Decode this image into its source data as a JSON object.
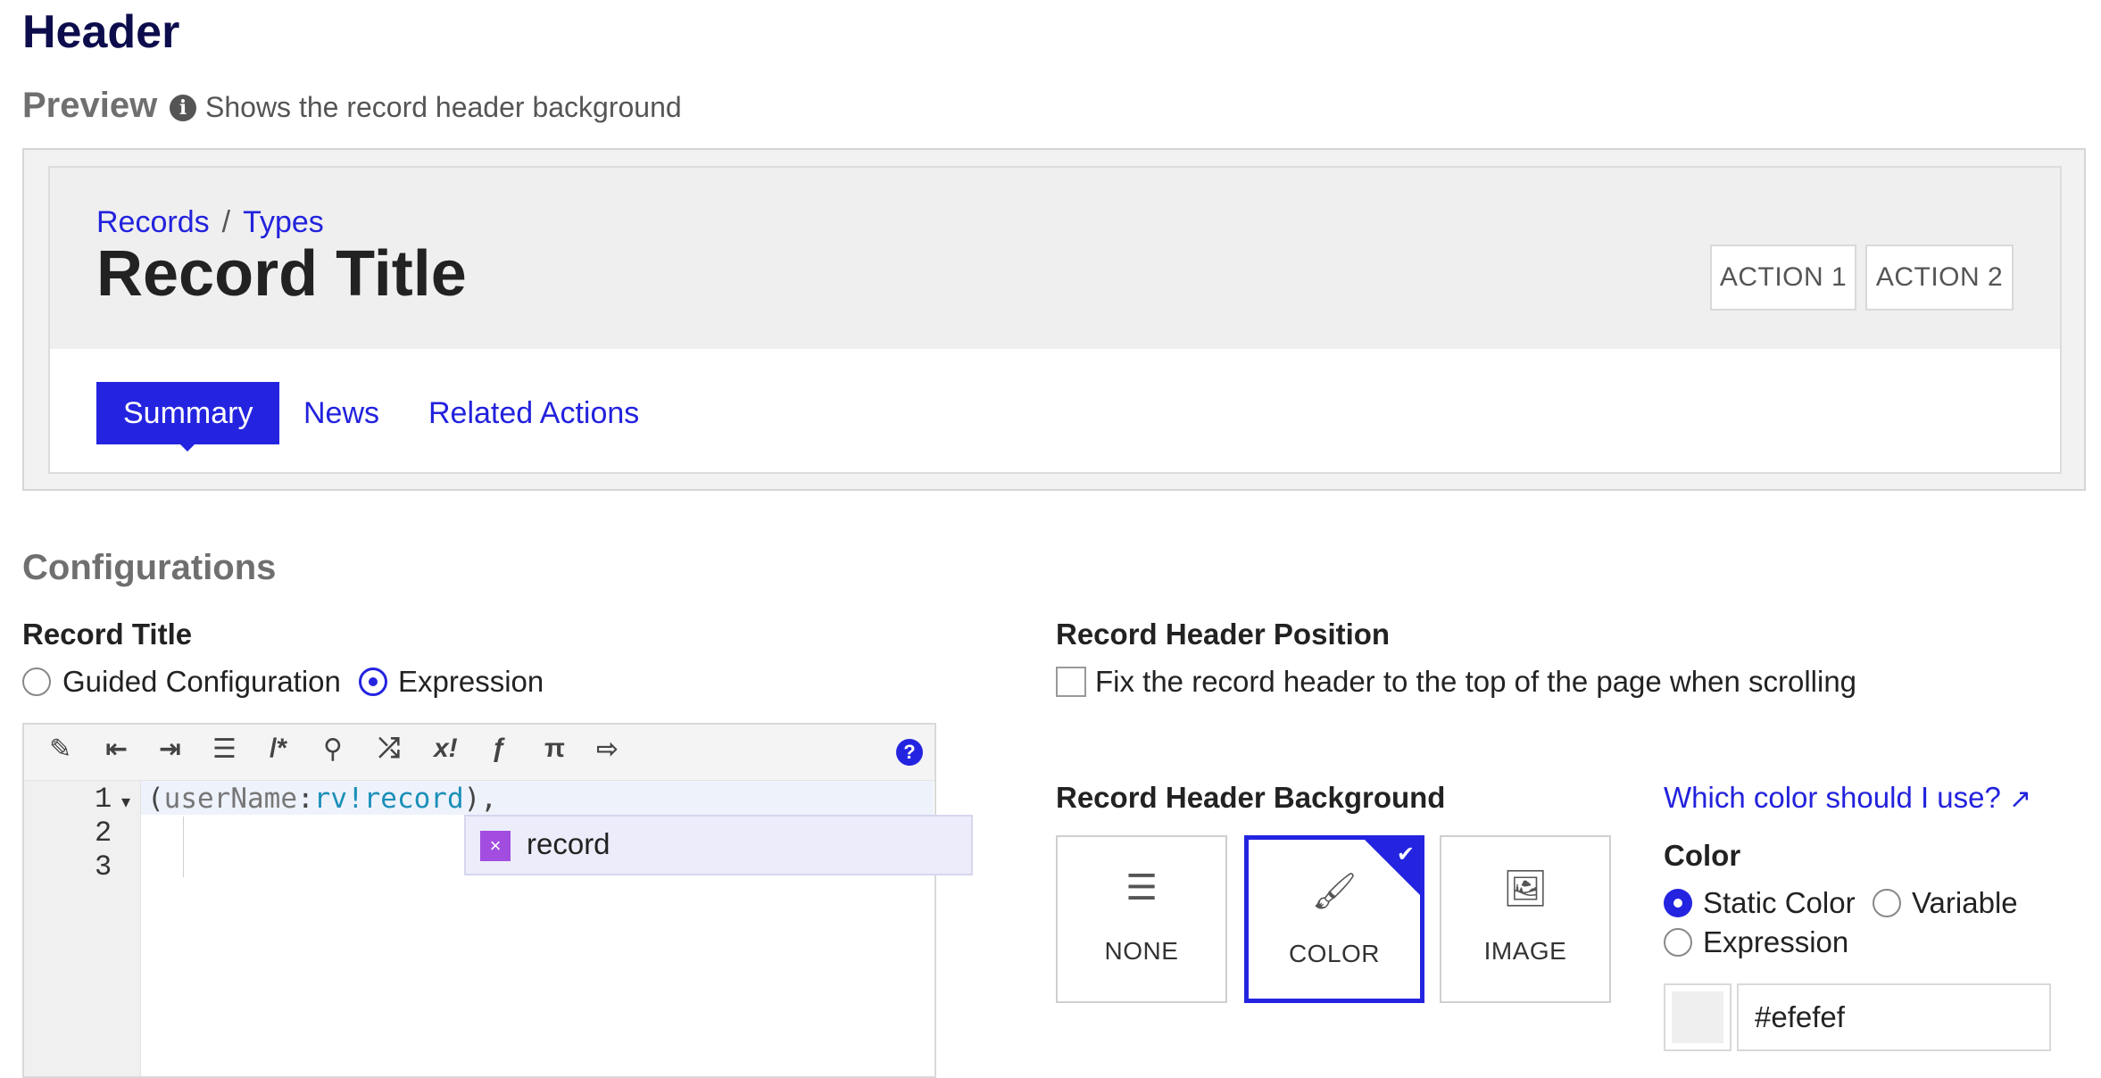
{
  "page": {
    "title": "Header"
  },
  "preview": {
    "label": "Preview",
    "hint": "Shows the record header background",
    "info_icon": "info-icon",
    "breadcrumb": [
      "Records",
      "Types"
    ],
    "breadcrumb_separator": "/",
    "record_title": "Record Title",
    "actions": [
      "ACTION 1",
      "ACTION 2"
    ],
    "tabs": [
      "Summary",
      "News",
      "Related Actions"
    ],
    "active_tab": "Summary",
    "header_background": "#efefef",
    "accent_color": "#2424e0"
  },
  "configurations": {
    "title": "Configurations",
    "record_title": {
      "label": "Record Title",
      "options": [
        "Guided Configuration",
        "Expression"
      ],
      "selected": "Expression"
    },
    "editor": {
      "toolbar_icons": [
        "magic-wand-icon",
        "outdent-icon",
        "indent-icon",
        "format-list-icon",
        "comment-icon",
        "search-icon",
        "shuffle-icon",
        "expression-icon",
        "function-icon",
        "pi-icon",
        "export-icon"
      ],
      "toolbar_glyphs": [
        "✎",
        "⇤",
        "⇥",
        "☰",
        "/*",
        "⚲",
        "⤮",
        "x!",
        "ƒ",
        "π",
        "⇨"
      ],
      "help_glyph": "?",
      "line_numbers": [
        "1",
        "2",
        "3"
      ],
      "fold_marker": "▾",
      "code_line_1": {
        "open": "(",
        "param": "userName",
        "colon": ":",
        "value": "rv!record",
        "close": "),"
      },
      "autocomplete": {
        "badge": "×",
        "text": "record"
      }
    },
    "header_position": {
      "label": "Record Header Position",
      "checkbox_label": "Fix the record header to the top of the page when scrolling",
      "checked": false
    },
    "header_background": {
      "label": "Record Header Background",
      "help_link": "Which color should I use?",
      "options": [
        {
          "label": "NONE",
          "icon": "align-left-icon",
          "glyph": "☰"
        },
        {
          "label": "COLOR",
          "icon": "paintbrush-icon",
          "glyph": "🖌"
        },
        {
          "label": "IMAGE",
          "icon": "image-icon",
          "glyph": "🖼"
        }
      ],
      "selected": "COLOR",
      "check_glyph": "✔"
    },
    "color": {
      "label": "Color",
      "options": [
        "Static Color",
        "Variable",
        "Expression"
      ],
      "selected": "Static Color",
      "value": "#efefef"
    }
  }
}
